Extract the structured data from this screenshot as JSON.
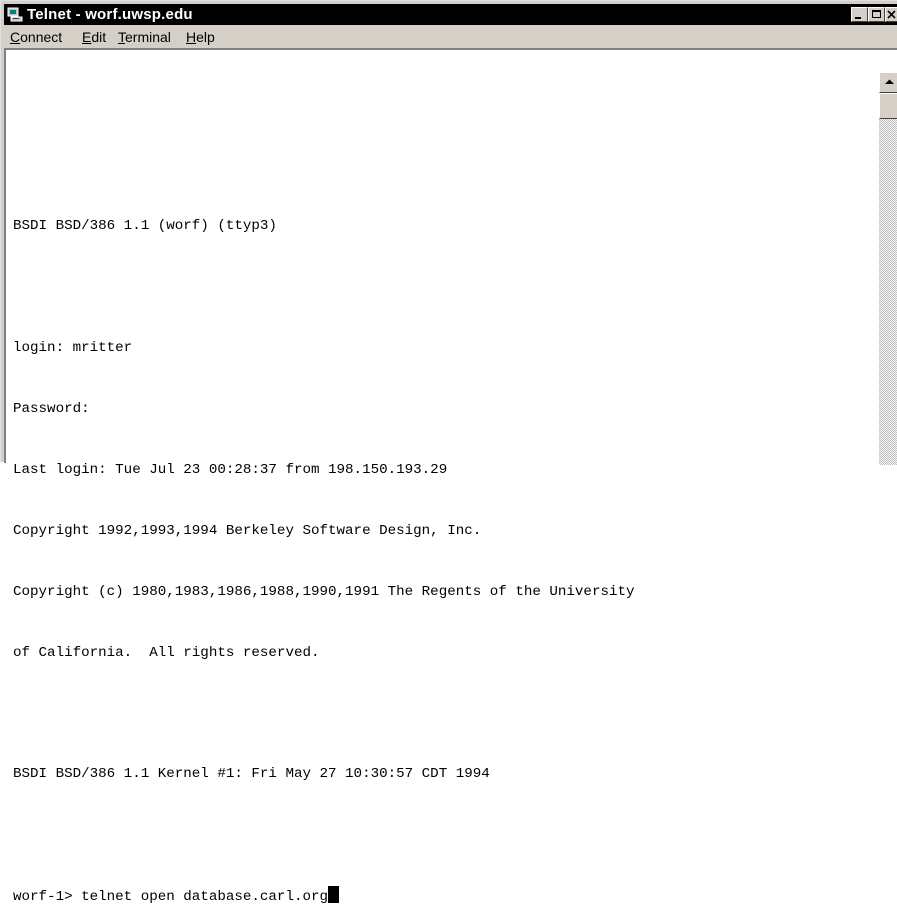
{
  "window": {
    "title": "Telnet - worf.uwsp.edu",
    "icon": "computer-icon"
  },
  "menu": {
    "items": [
      {
        "hotkey": "C",
        "rest": "onnect"
      },
      {
        "hotkey": "E",
        "rest": "dit"
      },
      {
        "hotkey": "T",
        "rest": "erminal"
      },
      {
        "hotkey": "H",
        "rest": "elp"
      }
    ]
  },
  "terminal": {
    "lines": [
      "",
      "",
      "BSDI BSD/386 1.1 (worf) (ttyp3)",
      "",
      "login: mritter",
      "Password:",
      "Last login: Tue Jul 23 00:28:37 from 198.150.193.29",
      "Copyright 1992,1993,1994 Berkeley Software Design, Inc.",
      "Copyright (c) 1980,1983,1986,1988,1990,1991 The Regents of the University",
      "of California.  All rights reserved.",
      "",
      "BSDI BSD/386 1.1 Kernel #1: Fri May 27 10:30:57 CDT 1994",
      "",
      "worf-1> telnet open database.carl.org"
    ]
  },
  "colors": {
    "titlebar": "#000000",
    "chrome": "#d4d0c8",
    "terminal_bg": "#ffffff",
    "terminal_fg": "#000000"
  }
}
